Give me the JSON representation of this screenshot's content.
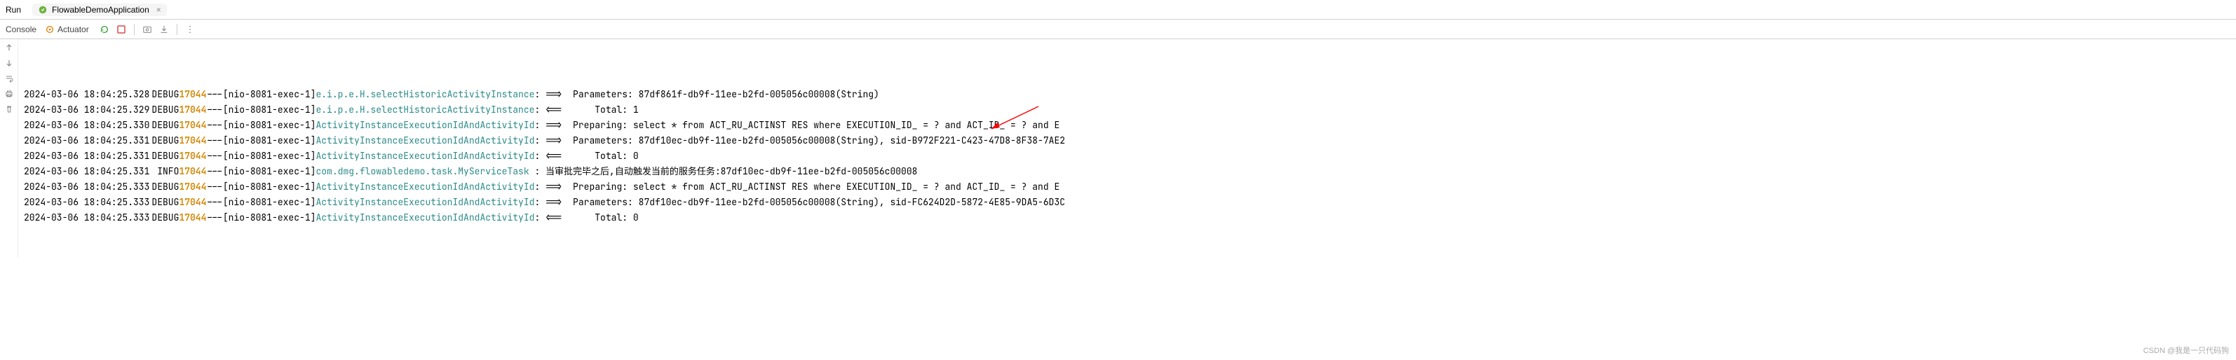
{
  "topbar": {
    "run_label": "Run",
    "tab_label": "FlowableDemoApplication",
    "tab_close": "×"
  },
  "toolbar": {
    "console_label": "Console",
    "actuator_label": "Actuator"
  },
  "watermark": "CSDN @我是一只代码狗",
  "logs": [
    {
      "ts": "2024-03-06 18:04:25.328",
      "level": "DEBUG",
      "pid": "17044",
      "sep": "---",
      "thread": "[nio-8081-exec-1]",
      "logger": "e.i.p.e.H.selectHistoricActivityInstance",
      "msg": ": ==>  Parameters: 87df861f-db9f-11ee-b2fd-005056c00008(String)"
    },
    {
      "ts": "2024-03-06 18:04:25.329",
      "level": "DEBUG",
      "pid": "17044",
      "sep": "---",
      "thread": "[nio-8081-exec-1]",
      "logger": "e.i.p.e.H.selectHistoricActivityInstance",
      "msg": ": <==      Total: 1"
    },
    {
      "ts": "2024-03-06 18:04:25.330",
      "level": "DEBUG",
      "pid": "17044",
      "sep": "---",
      "thread": "[nio-8081-exec-1]",
      "logger": "ActivityInstanceExecutionIdAndActivityId",
      "msg": ": ==>  Preparing: select * from ACT_RU_ACTINST RES where EXECUTION_ID_ = ? and ACT_ID_ = ? and E"
    },
    {
      "ts": "2024-03-06 18:04:25.331",
      "level": "DEBUG",
      "pid": "17044",
      "sep": "---",
      "thread": "[nio-8081-exec-1]",
      "logger": "ActivityInstanceExecutionIdAndActivityId",
      "msg": ": ==>  Parameters: 87df10ec-db9f-11ee-b2fd-005056c00008(String), sid-B972F221-C423-47D8-8F38-7AE2"
    },
    {
      "ts": "2024-03-06 18:04:25.331",
      "level": "DEBUG",
      "pid": "17044",
      "sep": "---",
      "thread": "[nio-8081-exec-1]",
      "logger": "ActivityInstanceExecutionIdAndActivityId",
      "msg": ": <==      Total: 0"
    },
    {
      "ts": "2024-03-06 18:04:25.331",
      "level": " INFO",
      "pid": "17044",
      "sep": "---",
      "thread": "[nio-8081-exec-1]",
      "logger": "com.dmg.flowabledemo.task.MyServiceTask ",
      "msg": ": 当审批完毕之后,自动触发当前的服务任务:87df10ec-db9f-11ee-b2fd-005056c00008"
    },
    {
      "ts": "2024-03-06 18:04:25.333",
      "level": "DEBUG",
      "pid": "17044",
      "sep": "---",
      "thread": "[nio-8081-exec-1]",
      "logger": "ActivityInstanceExecutionIdAndActivityId",
      "msg": ": ==>  Preparing: select * from ACT_RU_ACTINST RES where EXECUTION_ID_ = ? and ACT_ID_ = ? and E"
    },
    {
      "ts": "2024-03-06 18:04:25.333",
      "level": "DEBUG",
      "pid": "17044",
      "sep": "---",
      "thread": "[nio-8081-exec-1]",
      "logger": "ActivityInstanceExecutionIdAndActivityId",
      "msg": ": ==>  Parameters: 87df10ec-db9f-11ee-b2fd-005056c00008(String), sid-FC624D2D-5872-4E85-9DA5-6D3C"
    },
    {
      "ts": "2024-03-06 18:04:25.333",
      "level": "DEBUG",
      "pid": "17044",
      "sep": "---",
      "thread": "[nio-8081-exec-1]",
      "logger": "ActivityInstanceExecutionIdAndActivityId",
      "msg": ": <==      Total: 0"
    }
  ],
  "colors": {
    "pid": "#d48806",
    "logger": "#2e8b8b",
    "arrow": "#ff0000"
  }
}
